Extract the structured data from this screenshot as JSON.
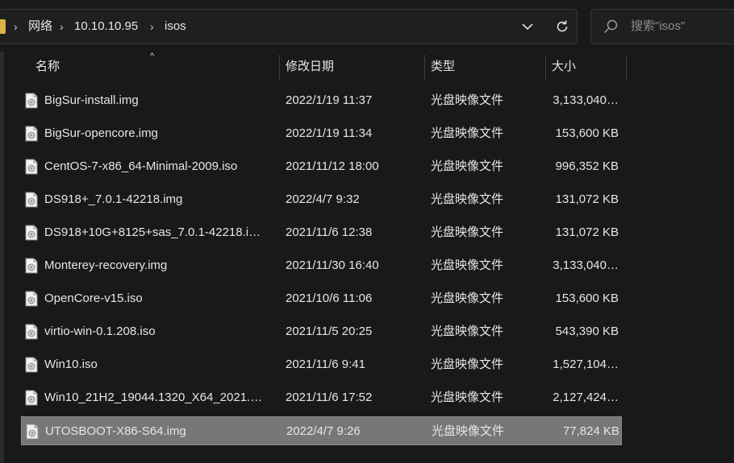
{
  "address_bar": {
    "breadcrumbs": [
      "网络",
      "10.10.10.95",
      "isos"
    ]
  },
  "search": {
    "placeholder": "搜索\"isos\""
  },
  "columns": {
    "name": "名称",
    "date": "修改日期",
    "type": "类型",
    "size": "大小"
  },
  "files": [
    {
      "name": "BigSur-install.img",
      "date": "2022/1/19 11:37",
      "type": "光盘映像文件",
      "size": "3,133,040…"
    },
    {
      "name": "BigSur-opencore.img",
      "date": "2022/1/19 11:34",
      "type": "光盘映像文件",
      "size": "153,600 KB"
    },
    {
      "name": "CentOS-7-x86_64-Minimal-2009.iso",
      "date": "2021/11/12 18:00",
      "type": "光盘映像文件",
      "size": "996,352 KB"
    },
    {
      "name": "DS918+_7.0.1-42218.img",
      "date": "2022/4/7 9:32",
      "type": "光盘映像文件",
      "size": "131,072 KB"
    },
    {
      "name": "DS918+10G+8125+sas_7.0.1-42218.i…",
      "date": "2021/11/6 12:38",
      "type": "光盘映像文件",
      "size": "131,072 KB"
    },
    {
      "name": "Monterey-recovery.img",
      "date": "2021/11/30 16:40",
      "type": "光盘映像文件",
      "size": "3,133,040…"
    },
    {
      "name": "OpenCore-v15.iso",
      "date": "2021/10/6 11:06",
      "type": "光盘映像文件",
      "size": "153,600 KB"
    },
    {
      "name": "virtio-win-0.1.208.iso",
      "date": "2021/11/5 20:25",
      "type": "光盘映像文件",
      "size": "543,390 KB"
    },
    {
      "name": "Win10.iso",
      "date": "2021/11/6 9:41",
      "type": "光盘映像文件",
      "size": "1,527,104…"
    },
    {
      "name": "Win10_21H2_19044.1320_X64_2021.…",
      "date": "2021/11/6 17:52",
      "type": "光盘映像文件",
      "size": "2,127,424…"
    },
    {
      "name": "UTOSBOOT-X86-S64.img",
      "date": "2022/4/7 9:26",
      "type": "光盘映像文件",
      "size": "77,824 KB",
      "selected": true
    }
  ]
}
